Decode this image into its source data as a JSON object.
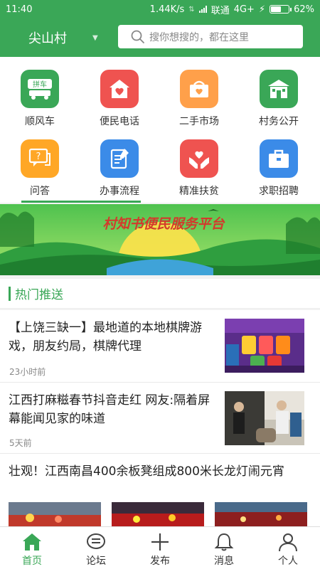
{
  "status_bar": {
    "time": "11:40",
    "network_speed": "1.44K/s",
    "carrier": "联通",
    "network_type": "4G+",
    "battery": "62%",
    "battery_level": 0.62
  },
  "header": {
    "village": "尖山村",
    "search_placeholder": "搜你想搜的，都在这里"
  },
  "grid": [
    {
      "label": "顺风车",
      "color": "#3aa757",
      "icon": "carpool-icon",
      "badge": "拼车"
    },
    {
      "label": "便民电话",
      "color": "#ef5350",
      "icon": "house-heart-icon"
    },
    {
      "label": "二手市场",
      "color": "#ffa04a",
      "icon": "basket-icon"
    },
    {
      "label": "村务公开",
      "color": "#3aa757",
      "icon": "building-icon"
    },
    {
      "label": "问答",
      "color": "#ffa726",
      "icon": "question-chat-icon"
    },
    {
      "label": "办事流程",
      "color": "#3b8be8",
      "icon": "document-edit-icon"
    },
    {
      "label": "精准扶贫",
      "color": "#ef5350",
      "icon": "hands-heart-icon"
    },
    {
      "label": "求职招聘",
      "color": "#3b8be8",
      "icon": "briefcase-icon"
    }
  ],
  "banner": {
    "title": "村知书便民服务平台"
  },
  "section": {
    "title": "热门推送"
  },
  "news": [
    {
      "title": "【上饶三缺一】最地道的本地棋牌游戏，朋友约局，棋牌代理",
      "time": "23小时前"
    },
    {
      "title": "江西打麻糍春节抖音走红 网友:隔着屏幕能闻见家的味道",
      "time": "5天前"
    },
    {
      "title": "壮观！江西南昌400余板凳组成800米长龙灯闹元宵"
    }
  ],
  "tabbar": [
    {
      "label": "首页",
      "icon": "home-icon",
      "active": true
    },
    {
      "label": "论坛",
      "icon": "chat-bubble-icon"
    },
    {
      "label": "发布",
      "icon": "plus-icon"
    },
    {
      "label": "消息",
      "icon": "bell-icon"
    },
    {
      "label": "个人",
      "icon": "person-icon"
    }
  ],
  "colors": {
    "accent": "#3aa757"
  }
}
